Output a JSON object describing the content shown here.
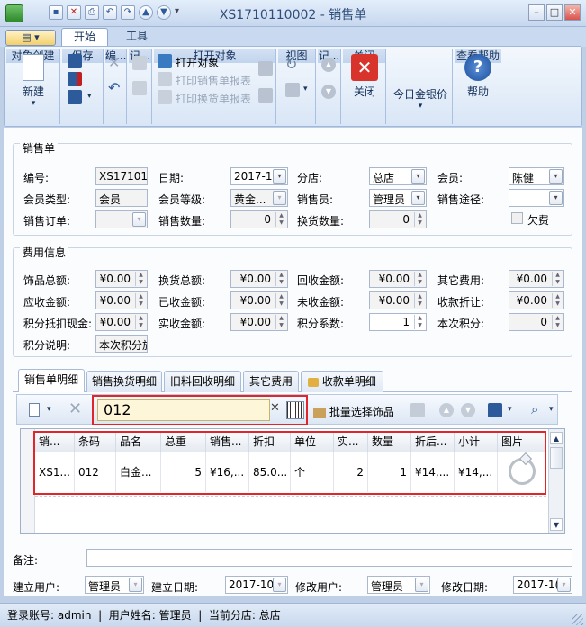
{
  "window": {
    "title": "XS1710110002 - 销售单"
  },
  "ribbon": {
    "app_menu_icon": "app-menu-icon",
    "tabs": [
      "开始",
      "工具"
    ],
    "groups": {
      "create": {
        "label": "对象创建",
        "new_label": "新建"
      },
      "save": {
        "label": "保存"
      },
      "edit": {
        "label": "编..."
      },
      "record": {
        "label": "记..."
      },
      "open": {
        "label": "打开对象",
        "open_obj": "打开对象",
        "print_sale": "打印销售单报表",
        "print_exchange": "打印换货单报表"
      },
      "view": {
        "label": "视图"
      },
      "record2": {
        "label": "记..."
      },
      "close": {
        "label": "关闭",
        "close_label": "关闭"
      },
      "gold": {
        "label": "",
        "gold_label": "今日金银价"
      },
      "help": {
        "label": "查看帮助",
        "help_label": "帮助"
      }
    }
  },
  "sales": {
    "section_title": "销售单",
    "fields": {
      "code_label": "编号:",
      "code": "XS171011",
      "date_label": "日期:",
      "date": "2017-1(",
      "store_label": "分店:",
      "store": "总店",
      "member_label": "会员:",
      "member": "陈健",
      "member_type_label": "会员类型:",
      "member_type": "会员",
      "member_level_label": "会员等级:",
      "member_level": "黄金...",
      "seller_label": "销售员:",
      "seller": "管理员",
      "channel_label": "销售途径:",
      "channel": "",
      "order_label": "销售订单:",
      "order": "",
      "qty_label": "销售数量:",
      "qty": "0",
      "exchange_qty_label": "换货数量:",
      "exchange_qty": "0",
      "owe_label": "欠费"
    }
  },
  "fees": {
    "section_title": "费用信息",
    "jewelry_total_label": "饰品总额:",
    "jewelry_total": "¥0.00",
    "exchange_total_label": "换货总额:",
    "exchange_total": "¥0.00",
    "recycle_label": "回收金额:",
    "recycle": "¥0.00",
    "other_fee_label": "其它费用:",
    "other_fee": "¥0.00",
    "receivable_label": "应收金额:",
    "receivable": "¥0.00",
    "received_label": "已收金额:",
    "received": "¥0.00",
    "unreceived_label": "未收金额:",
    "unreceived": "¥0.00",
    "discount_label": "收款折让:",
    "discount": "¥0.00",
    "points_cash_label": "积分抵扣现金:",
    "points_cash": "¥0.00",
    "actual_label": "实收金额:",
    "actual": "¥0.00",
    "points_factor_label": "积分系数:",
    "points_factor": "1",
    "current_points_label": "本次积分:",
    "current_points": "0",
    "points_note_label": "积分说明:",
    "points_note": "本次积分旅"
  },
  "detail_tabs": [
    "销售单明细",
    "销售换货明细",
    "旧料回收明细",
    "其它费用",
    "收款单明细"
  ],
  "detail_toolbar": {
    "barcode_input": "012",
    "batch_label": "批量选择饰品"
  },
  "grid": {
    "headers": [
      "销...",
      "条码",
      "品名",
      "总重",
      "销售...",
      "折扣",
      "单位",
      "实...",
      "数量",
      "折后...",
      "小计",
      "图片"
    ],
    "row": [
      "XS1...",
      "012",
      "白金...",
      "5",
      "¥16,...",
      "85.0...",
      "个",
      "2",
      "1",
      "¥14,...",
      "¥14,..."
    ]
  },
  "footer": {
    "remark_label": "备注:",
    "remark": "",
    "creator_label": "建立用户:",
    "creator": "管理员",
    "create_date_label": "建立日期:",
    "create_date": "2017-10",
    "modifier_label": "修改用户:",
    "modifier": "管理员",
    "modify_date_label": "修改日期:",
    "modify_date": "2017-1("
  },
  "status": {
    "text": "登录账号: admin  |  用户姓名: 管理员  |  当前分店: 总店"
  },
  "colors": {
    "accent": "#2d5a9a",
    "highlight": "#e0262b",
    "tab_active": "#fff3c8"
  }
}
